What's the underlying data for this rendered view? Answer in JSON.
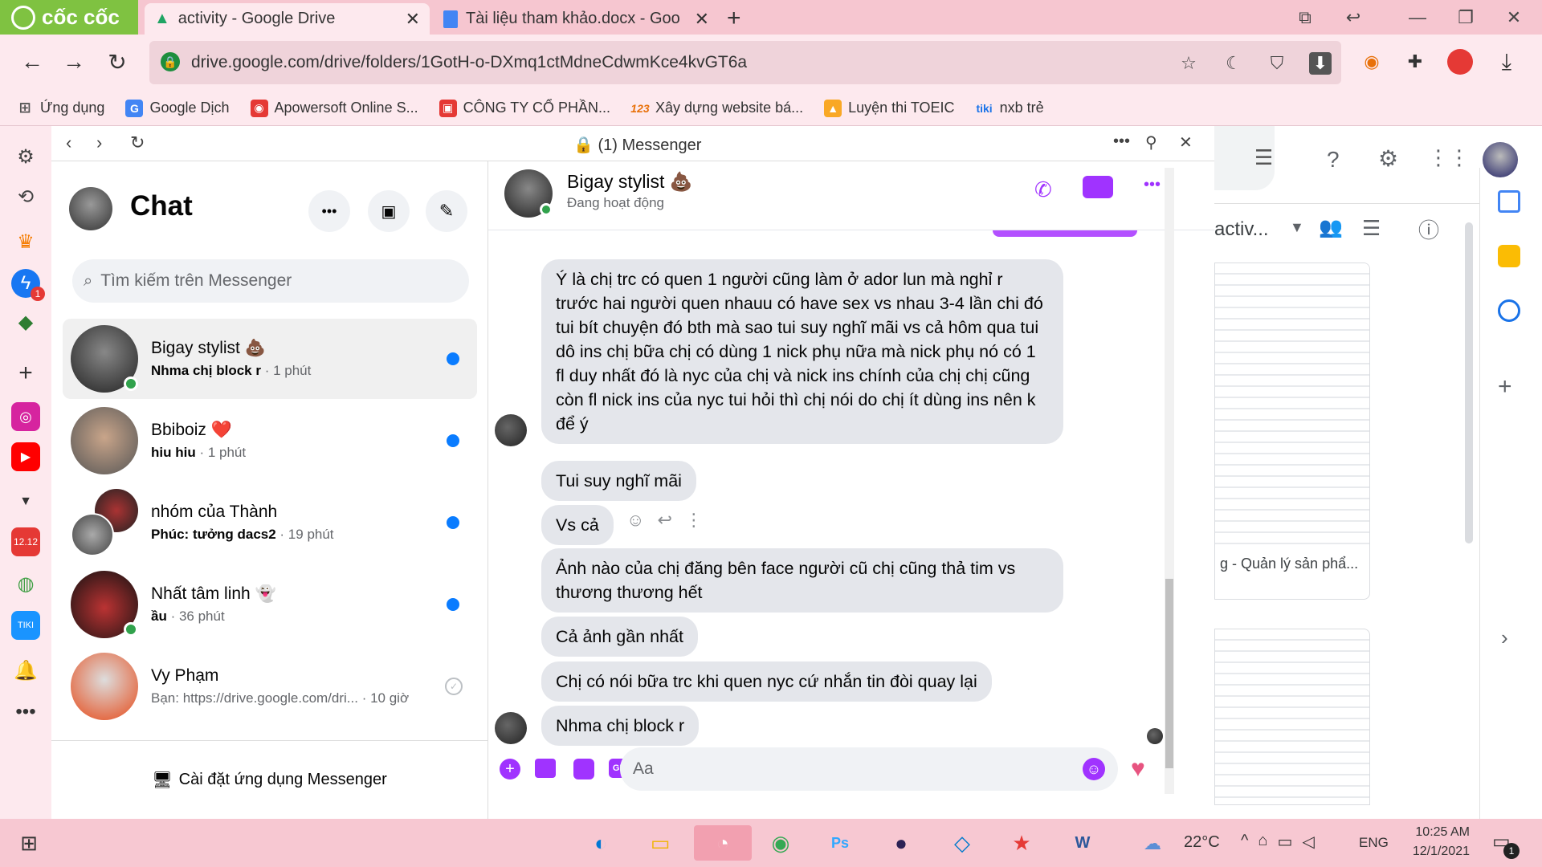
{
  "browser": {
    "brand": "cốc cốc",
    "tabs": [
      {
        "title": "activity - Google Drive"
      },
      {
        "title": "Tài liệu tham khảo.docx - Goo"
      }
    ],
    "url": "drive.google.com/drive/folders/1GotH-o-DXmq1ctMdneCdwmKce4kvGT6a",
    "bookmarks": [
      "Ứng dụng",
      "Google Dịch",
      "Apowersoft Online S...",
      "CÔNG TY CỔ PHẦN...",
      "Xây dựng website bá...",
      "Luyện thi TOEIC",
      "nxb trẻ"
    ]
  },
  "sidebar": {
    "messenger_badge": "1"
  },
  "messenger": {
    "window_title": "(1) Messenger",
    "chat_title": "Chat",
    "search_placeholder": "Tìm kiếm trên Messenger",
    "install_label": "Cài đặt ứng dụng Messenger",
    "conversations": [
      {
        "name": "Bigay stylist 💩",
        "preview": "Nhma chị block r",
        "time": " · 1 phút",
        "unread": true,
        "online": true
      },
      {
        "name": "Bbiboiz ❤️",
        "preview": "hiu hiu",
        "time": " · 1 phút",
        "unread": true,
        "online": false
      },
      {
        "name": "nhóm của Thành",
        "preview": "Phúc: tưởng dacs2",
        "time": " · 19 phút",
        "unread": true,
        "online": false
      },
      {
        "name": "Nhất tâm linh 👻",
        "preview": "ầu",
        "time": " · 36 phút",
        "unread": true,
        "online": true
      },
      {
        "name": "Vy Phạm",
        "preview": "Bạn: https://drive.google.com/dri...",
        "time": " · 10 giờ",
        "unread": false,
        "online": false
      }
    ],
    "active": {
      "name": "Bigay stylist 💩",
      "status": "Đang hoạt động",
      "messages": [
        "Ý là chị trc có quen 1 người cũng làm ở ador lun mà nghỉ r trước hai người quen nhauu có have sex vs nhau 3-4 lần chi đó tui bít chuyện đó bth mà sao tui suy nghĩ mãi vs cả hôm qua tui dô ins chị bữa chị có dùng 1 nick phụ nữa mà nick phụ nó có 1 fl duy nhất đó là nyc của chị và nick ins chính của chị chị cũng còn fl nick ins của nyc tui hỏi thì chị nói do chị ít dùng ins nên k để ý",
        "Tui suy nghĩ mãi",
        "Vs cả",
        "Ảnh nào của chị đăng bên face người cũ chị cũng thả tim vs thương thương hết",
        "Cả ảnh gần nhất",
        "Chị có nói bữa trc khi quen nyc cứ nhắn tin đòi quay lại",
        "Nhma chị block r"
      ],
      "composer_placeholder": "Aa",
      "gif_label": "GIF"
    }
  },
  "drive": {
    "folder_name": "activ...",
    "file_name": "g - Quản lý sản phẩ..."
  },
  "taskbar": {
    "temperature": "22°C",
    "language": "ENG",
    "time": "10:25 AM",
    "date": "12/1/2021",
    "notif_count": "1"
  },
  "colors": {
    "messenger_accent": "#a033ff",
    "unread_dot": "#0a7cff",
    "online": "#31a24c"
  }
}
